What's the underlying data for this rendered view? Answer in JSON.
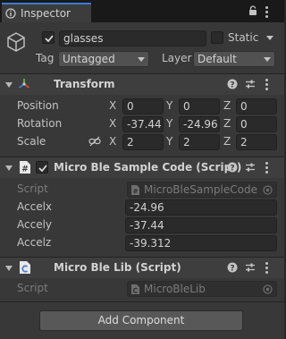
{
  "tab": {
    "label": "Inspector"
  },
  "gameobject": {
    "active": true,
    "name": "glasses",
    "static_label": "Static",
    "tag_label": "Tag",
    "tag_value": "Untagged",
    "layer_label": "Layer",
    "layer_value": "Default"
  },
  "transform": {
    "title": "Transform",
    "position": {
      "label": "Position",
      "x": "0",
      "y": "0",
      "z": "0"
    },
    "rotation": {
      "label": "Rotation",
      "x": "-37.44",
      "y": "-24.96",
      "z": "0"
    },
    "scale": {
      "label": "Scale",
      "x": "2",
      "y": "2",
      "z": "2"
    },
    "axis_x": "X",
    "axis_y": "Y",
    "axis_z": "Z"
  },
  "sample_code": {
    "enabled": true,
    "title": "Micro Ble Sample Code (Script)",
    "script_label": "Script",
    "script_value": "MicroBleSampleCode",
    "fields": [
      {
        "label": "Accelx",
        "value": "-24.96"
      },
      {
        "label": "Accely",
        "value": "-37.44"
      },
      {
        "label": "Accelz",
        "value": "-39.312"
      }
    ]
  },
  "ble_lib": {
    "title": "Micro Ble Lib (Script)",
    "script_label": "Script",
    "script_value": "MicroBleLib"
  },
  "add_component": {
    "label": "Add Component"
  },
  "colors": {
    "accent": "#3a7dd5",
    "panel": "#383838",
    "field": "#2a2a2a"
  }
}
